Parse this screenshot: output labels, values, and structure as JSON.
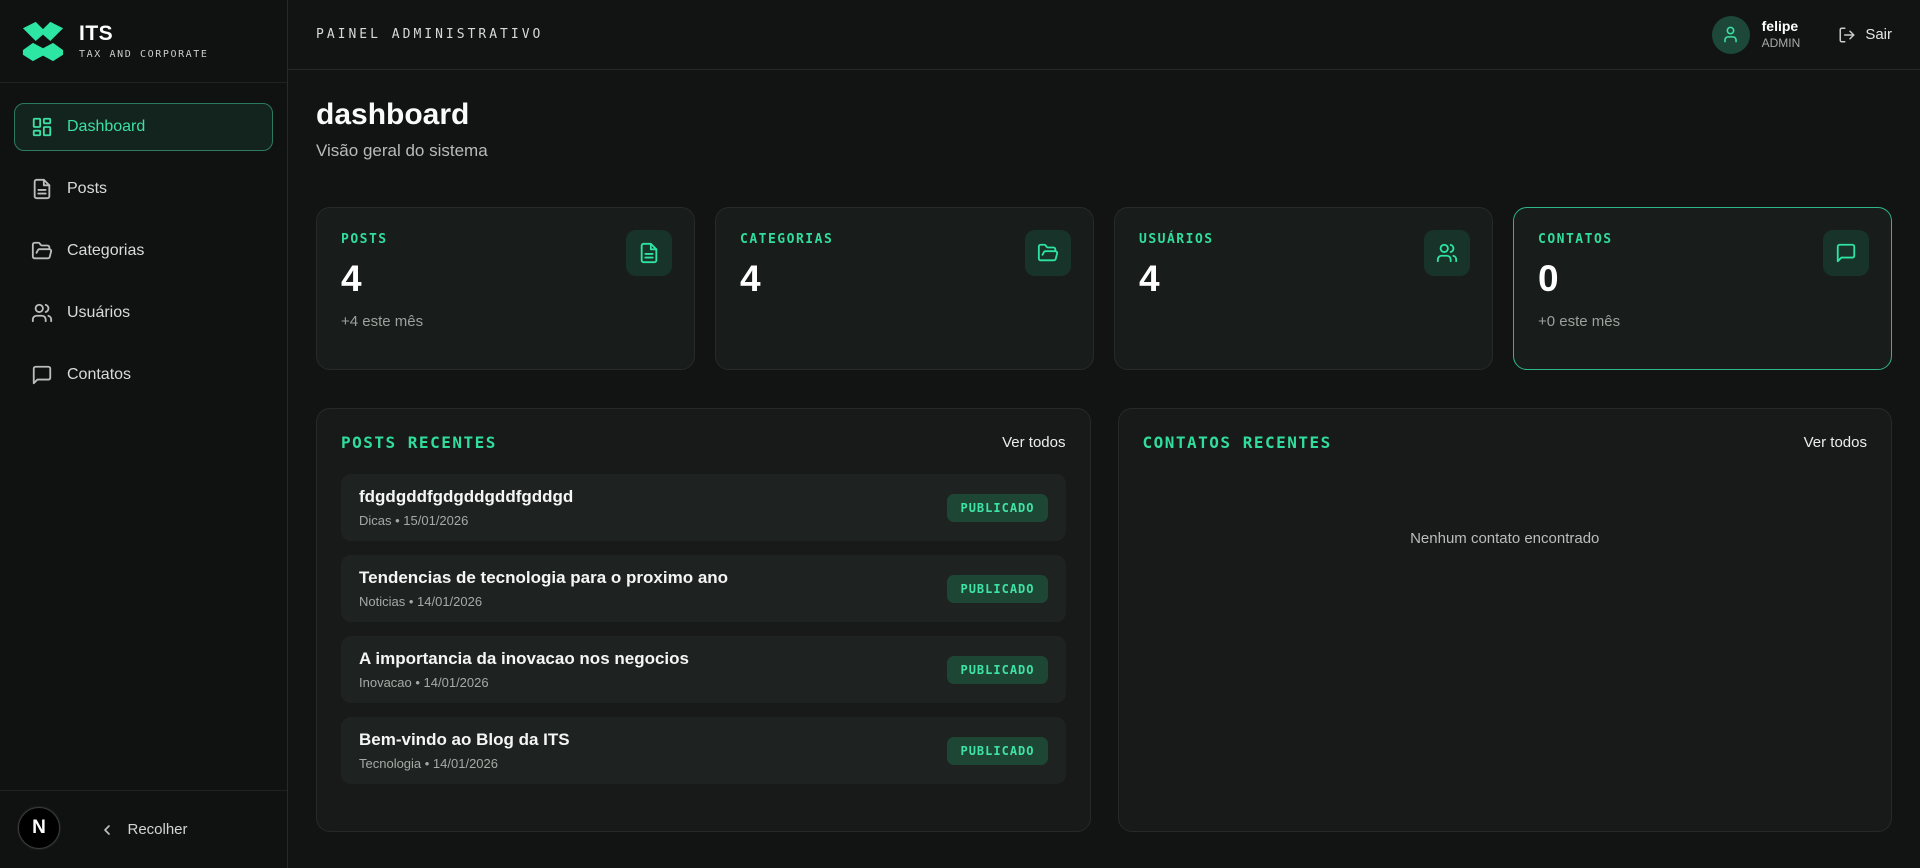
{
  "brand": {
    "name": "ITS",
    "tagline": "TAX AND CORPORATE"
  },
  "topbar": {
    "title": "PAINEL ADMINISTRATIVO",
    "user": {
      "name": "felipe",
      "role": "ADMIN"
    },
    "logout": "Sair"
  },
  "sidebar": {
    "items": [
      {
        "label": "Dashboard",
        "icon": "dashboard-grid-icon",
        "active": true
      },
      {
        "label": "Posts",
        "icon": "file-text-icon",
        "active": false
      },
      {
        "label": "Categorias",
        "icon": "folder-open-icon",
        "active": false
      },
      {
        "label": "Usuários",
        "icon": "users-icon",
        "active": false
      },
      {
        "label": "Contatos",
        "icon": "message-square-icon",
        "active": false
      }
    ],
    "collapse_label": "Recolher",
    "dev_badge": "N"
  },
  "page": {
    "title": "dashboard",
    "subtitle": "Visão geral do sistema"
  },
  "stats": [
    {
      "label": "POSTS",
      "value": "4",
      "delta": "+4 este mês",
      "icon": "file-text-icon",
      "highlight": false
    },
    {
      "label": "CATEGORIAS",
      "value": "4",
      "delta": "",
      "icon": "folder-open-icon",
      "highlight": false
    },
    {
      "label": "USUÁRIOS",
      "value": "4",
      "delta": "",
      "icon": "users-icon",
      "highlight": false
    },
    {
      "label": "CONTATOS",
      "value": "0",
      "delta": "+0 este mês",
      "icon": "message-square-icon",
      "highlight": true
    }
  ],
  "posts_panel": {
    "title": "POSTS RECENTES",
    "action": "Ver todos",
    "items": [
      {
        "title": "fdgdgddfgdgddgddfgddgd",
        "meta": "Dicas • 15/01/2026",
        "status": "PUBLICADO"
      },
      {
        "title": "Tendencias de tecnologia para o proximo ano",
        "meta": "Noticias • 14/01/2026",
        "status": "PUBLICADO"
      },
      {
        "title": "A importancia da inovacao nos negocios",
        "meta": "Inovacao • 14/01/2026",
        "status": "PUBLICADO"
      },
      {
        "title": "Bem-vindo ao Blog da ITS",
        "meta": "Tecnologia • 14/01/2026",
        "status": "PUBLICADO"
      }
    ]
  },
  "contacts_panel": {
    "title": "CONTATOS RECENTES",
    "action": "Ver todos",
    "empty": "Nenhum contato encontrado"
  },
  "colors": {
    "accent": "#31dd9d",
    "accent_border": "#2fb687",
    "badge_bg": "#1d4734",
    "badge_text": "#3fe3a4",
    "icon_box_bg": "#17332a"
  }
}
